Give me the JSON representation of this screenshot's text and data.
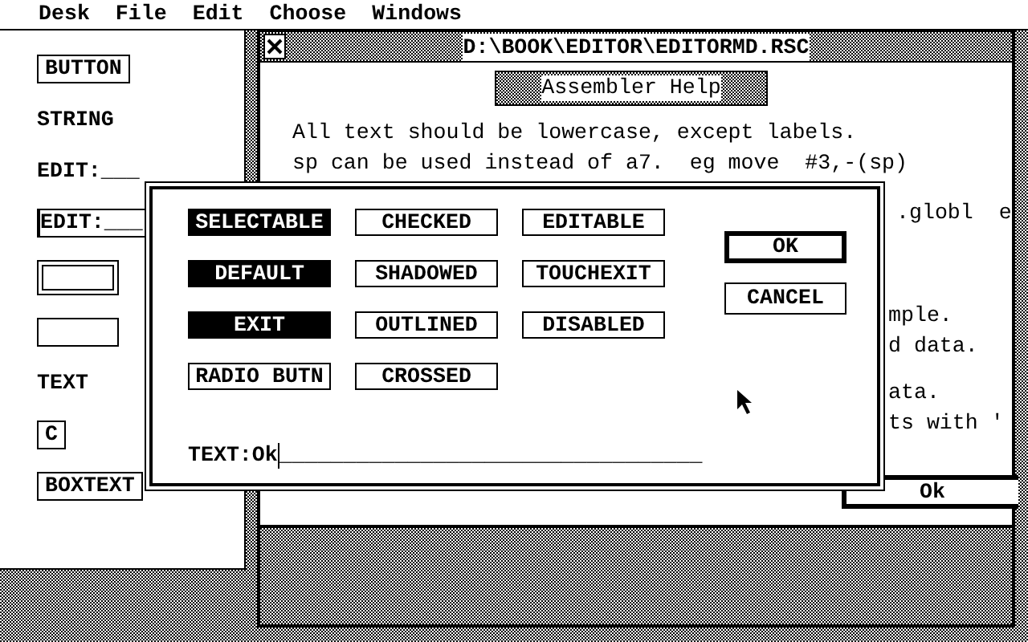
{
  "menu_bar": [
    "Desk",
    "File",
    "Edit",
    "Choose",
    "Windows"
  ],
  "parts_panel": [
    {
      "kind": "boxed",
      "label": "BUTTON"
    },
    {
      "kind": "plain",
      "label": "STRING"
    },
    {
      "kind": "plain",
      "label": "EDIT:___"
    },
    {
      "kind": "boxed_thick",
      "label": "EDIT:___"
    },
    {
      "kind": "outlined_box"
    },
    {
      "kind": "box"
    },
    {
      "kind": "plain",
      "label": "TEXT"
    },
    {
      "kind": "boxed",
      "label": "C"
    },
    {
      "kind": "boxed",
      "label": "BOXTEXT"
    }
  ],
  "window": {
    "title": "D:\\BOOK\\EDITOR\\EDITORMD.RSC",
    "help_title": "Assembler Help",
    "lines": [
      "All text should be lowercase, except labels.",
      "sp can be used instead of a7.  eg move  #3,-(sp)"
    ],
    "fragments": [
      ".globl  e",
      "mple.",
      "d data.",
      "ata.",
      "ts with '"
    ],
    "ok_button": "Ok"
  },
  "dialog": {
    "flags": [
      {
        "label": "SELECTABLE",
        "selected": true
      },
      {
        "label": "CHECKED",
        "selected": false
      },
      {
        "label": "EDITABLE",
        "selected": false
      },
      {
        "label": "DEFAULT",
        "selected": true
      },
      {
        "label": "SHADOWED",
        "selected": false
      },
      {
        "label": "TOUCHEXIT",
        "selected": false
      },
      {
        "label": "EXIT",
        "selected": true
      },
      {
        "label": "OUTLINED",
        "selected": false
      },
      {
        "label": "DISABLED",
        "selected": false
      },
      {
        "label": "RADIO BUTN",
        "selected": false
      },
      {
        "label": "CROSSED",
        "selected": false
      }
    ],
    "buttons": [
      {
        "label": "OK",
        "default": true
      },
      {
        "label": "CANCEL",
        "default": false
      }
    ],
    "text_field": {
      "label": "TEXT:",
      "value": "Ok",
      "blanks": "_________________________________"
    }
  }
}
